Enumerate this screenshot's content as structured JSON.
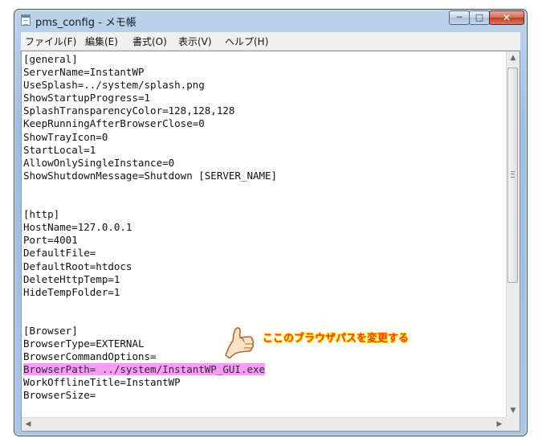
{
  "window": {
    "title": "pms_config - メモ帳",
    "controls": {
      "minimize": "─",
      "maximize": "□",
      "close": "✕"
    }
  },
  "menubar": {
    "items": [
      "ファイル(F)",
      "編集(E)",
      "書式(O)",
      "表示(V)",
      "ヘルプ(H)"
    ]
  },
  "editor": {
    "lines": [
      "[general]",
      "ServerName=InstantWP",
      "UseSplash=../system/splash.png",
      "ShowStartupProgress=1",
      "SplashTransparencyColor=128,128,128",
      "KeepRunningAfterBrowserClose=0",
      "ShowTrayIcon=0",
      "StartLocal=1",
      "AllowOnlySingleInstance=0",
      "ShowShutdownMessage=Shutdown [SERVER_NAME]",
      "",
      "",
      "[http]",
      "HostName=127.0.0.1",
      "Port=4001",
      "DefaultFile=",
      "DefaultRoot=htdocs",
      "DeleteHttpTemp=1",
      "HideTempFolder=1",
      "",
      "",
      "[Browser]",
      "BrowserType=EXTERNAL",
      "BrowserCommandOptions=",
      "BrowserPath= ../system/InstantWP_GUI.exe",
      "WorkOfflineTitle=InstantWP",
      "BrowserSize="
    ],
    "highlighted_line": 24,
    "highlight_color": "#f59cf5"
  },
  "annotation": {
    "text": "ここのブラウザパスを変更する",
    "text_color": "#ff3b1a",
    "glow_color": "#ffe600",
    "icon": "pointing-hand-icon"
  },
  "scrollbars": {
    "up_arrow": "▲",
    "down_arrow": "▼",
    "left_arrow": "◀",
    "right_arrow": "▶"
  }
}
